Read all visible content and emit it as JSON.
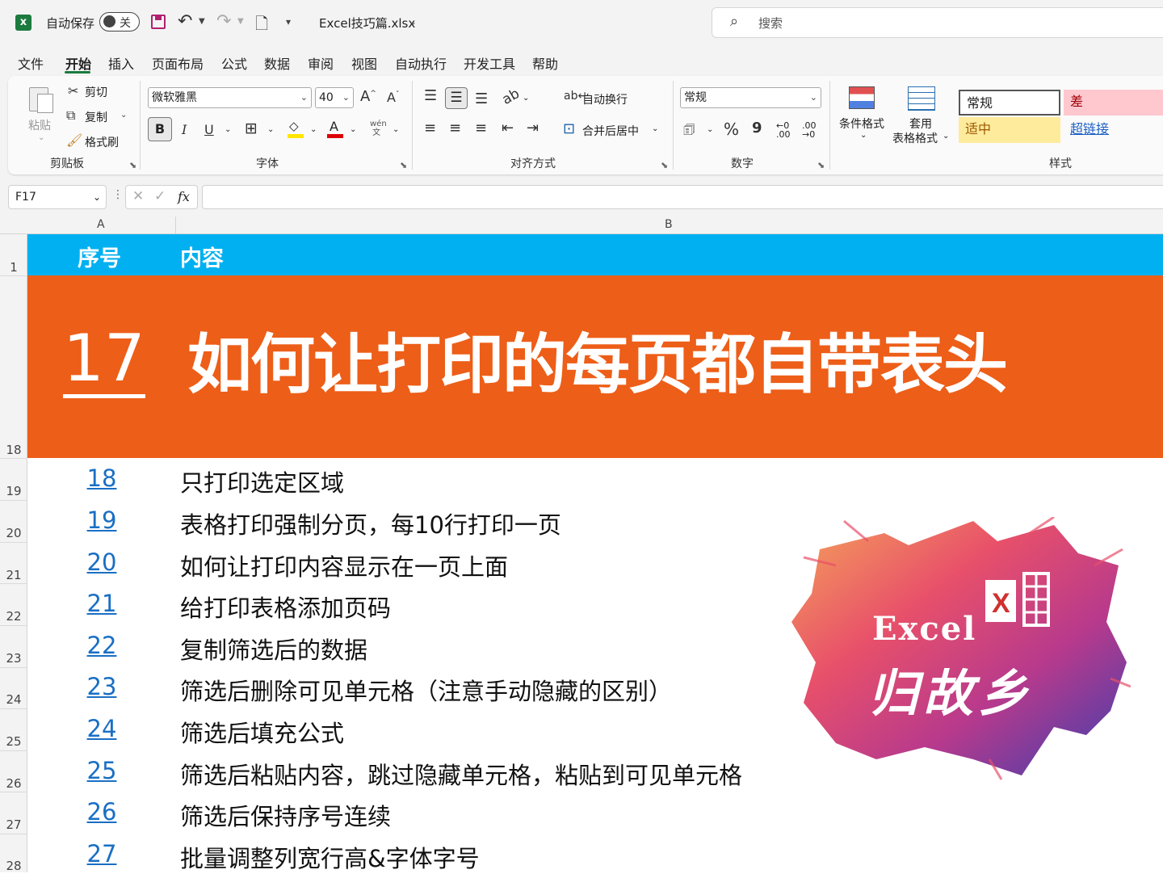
{
  "titlebar": {
    "autosave_label": "自动保存",
    "autosave_state": "关",
    "filename": "Excel技巧篇.xlsx",
    "search_placeholder": "搜索"
  },
  "menu": [
    "文件",
    "开始",
    "插入",
    "页面布局",
    "公式",
    "数据",
    "审阅",
    "视图",
    "自动执行",
    "开发工具",
    "帮助"
  ],
  "ribbon": {
    "clipboard": {
      "paste": "粘贴",
      "cut": "剪切",
      "copy": "复制",
      "format_painter": "格式刷",
      "label": "剪贴板"
    },
    "font": {
      "name": "微软雅黑",
      "size": "40",
      "bold": "B",
      "italic": "I",
      "underline": "U",
      "label": "字体"
    },
    "alignment": {
      "wrap": "自动换行",
      "merge": "合并后居中",
      "label": "对齐方式"
    },
    "number": {
      "format": "常规",
      "percent": "%",
      "comma": "9",
      "label": "数字"
    },
    "styles": {
      "conditional": "条件格式",
      "table_line1": "套用",
      "table_line2": "表格格式",
      "normal": "常规",
      "bad": "差",
      "neutral": "适中",
      "hyperlink": "超链接",
      "label": "样式"
    }
  },
  "formula_bar": {
    "name_box": "F17",
    "fx": "fx",
    "value": ""
  },
  "columns": [
    "A",
    "B"
  ],
  "sheet": {
    "header": {
      "row": "1",
      "col_a": "序号",
      "col_b": "内容"
    },
    "banner": {
      "row": "18",
      "number": "17",
      "title": "如何让打印的每页都自带表头"
    },
    "rows": [
      {
        "row": "19",
        "num": "18",
        "text": "只打印选定区域"
      },
      {
        "row": "20",
        "num": "19",
        "text": "表格打印强制分页，每10行打印一页"
      },
      {
        "row": "21",
        "num": "20",
        "text": "如何让打印内容显示在一页上面"
      },
      {
        "row": "22",
        "num": "21",
        "text": "给打印表格添加页码"
      },
      {
        "row": "23",
        "num": "22",
        "text": "复制筛选后的数据"
      },
      {
        "row": "24",
        "num": "23",
        "text": "筛选后删除可见单元格（注意手动隐藏的区别）"
      },
      {
        "row": "25",
        "num": "24",
        "text": "筛选后填充公式"
      },
      {
        "row": "26",
        "num": "25",
        "text": "筛选后粘贴内容，跳过隐藏单元格，粘贴到可见单元格"
      },
      {
        "row": "27",
        "num": "26",
        "text": "筛选后保持序号连续"
      },
      {
        "row": "28",
        "num": "27",
        "text": "批量调整列宽行高&字体字号"
      }
    ]
  },
  "logo": {
    "line1": "Excel",
    "line2": "归故乡"
  },
  "colors": {
    "header_blue": "#00b0f0",
    "banner_orange": "#ed5e18",
    "link_blue": "#1a6fc4",
    "excel_green": "#1b7a3e"
  }
}
